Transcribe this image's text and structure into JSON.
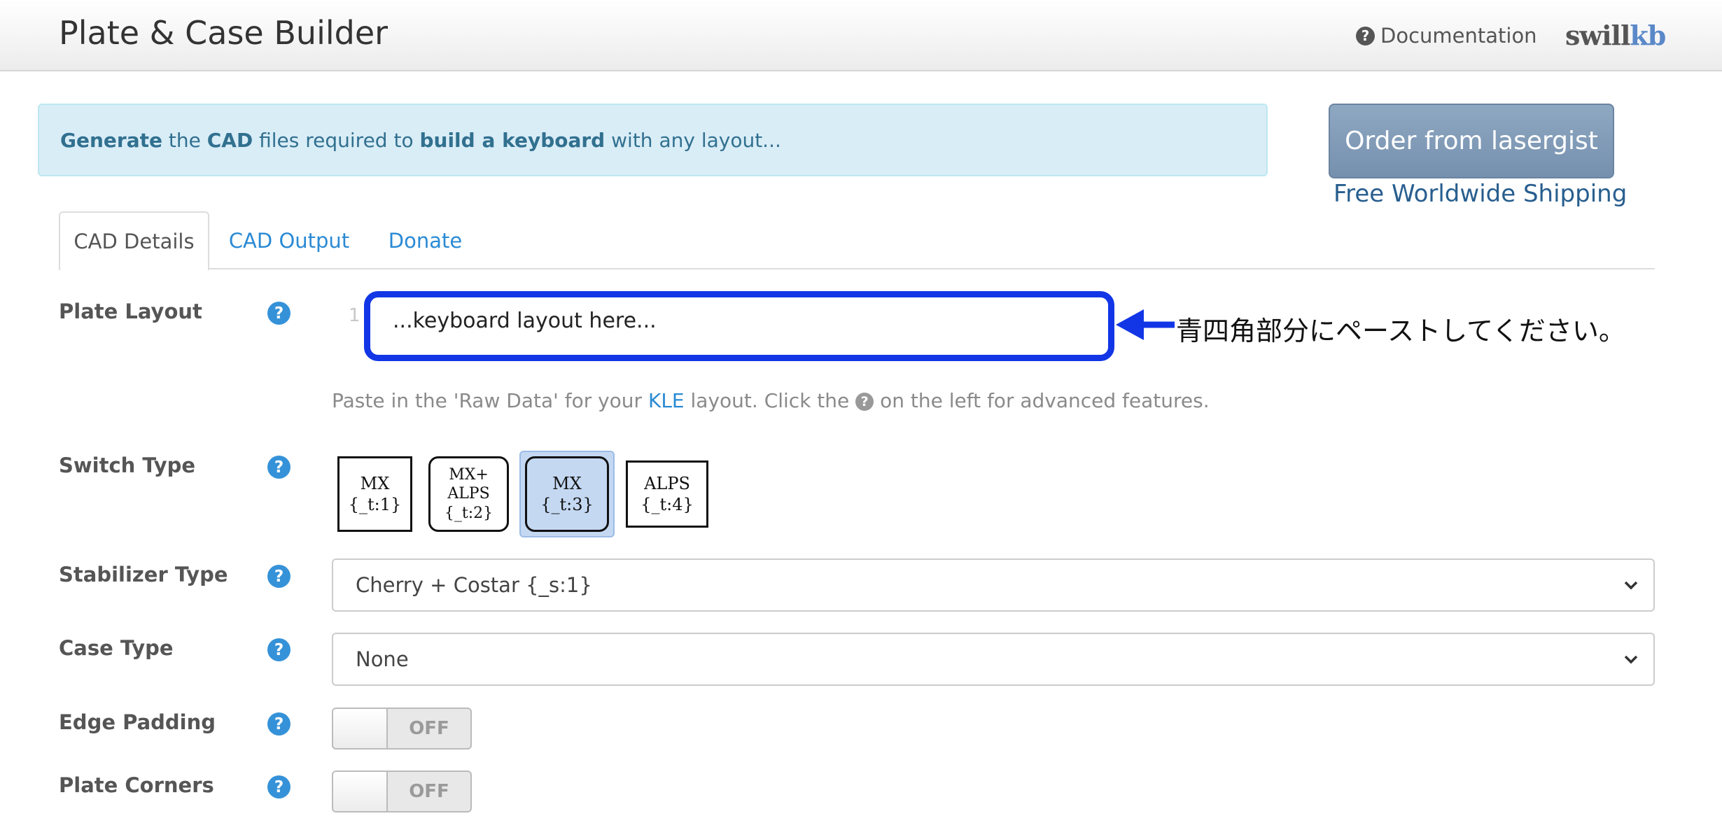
{
  "navbar": {
    "title": "Plate & Case Builder",
    "docs_label": "Documentation",
    "logo_part1": "swill",
    "logo_part2": "kb"
  },
  "alert": {
    "w1": "Generate",
    "w2": " the ",
    "w3": "CAD",
    "w4": " files required to ",
    "w5": "build a keyboard",
    "w6": " with any layout..."
  },
  "order": {
    "button_label": "Order from lasergist",
    "shipping_text": "Free Worldwide Shipping"
  },
  "tabs": [
    {
      "label": "CAD Details",
      "active": true
    },
    {
      "label": "CAD Output",
      "active": false
    },
    {
      "label": "Donate",
      "active": false
    }
  ],
  "plate_layout": {
    "label": "Plate Layout",
    "line_number": "1",
    "placeholder": "...keyboard layout here...",
    "annotation": "青四角部分にペーストしてください。",
    "hint_part1": "Paste in the 'Raw Data' for your ",
    "hint_link": "KLE",
    "hint_part2": " layout. Click the ",
    "hint_part3": " on the left for advanced features."
  },
  "switch_type": {
    "label": "Switch Type",
    "options": [
      {
        "line1": "MX",
        "line2": "{_t:1}",
        "line3": ""
      },
      {
        "line1": "MX+",
        "line2": "ALPS",
        "line3": "{_t:2}"
      },
      {
        "line1": "MX",
        "line2": "{_t:3}",
        "line3": ""
      },
      {
        "line1": "ALPS",
        "line2": "{_t:4}",
        "line3": ""
      }
    ],
    "selected_index": 2
  },
  "stabilizer_type": {
    "label": "Stabilizer Type",
    "value": "Cherry + Costar {_s:1}"
  },
  "case_type": {
    "label": "Case Type",
    "value": "None"
  },
  "edge_padding": {
    "label": "Edge Padding",
    "state": "OFF"
  },
  "plate_corners": {
    "label": "Plate Corners",
    "state": "OFF"
  },
  "help_glyph": "?",
  "colors": {
    "accent": "#2a8ad4",
    "annotation_blue": "#1236e6",
    "order_button": "#7f99b6",
    "alert_bg": "#d9edf7"
  }
}
